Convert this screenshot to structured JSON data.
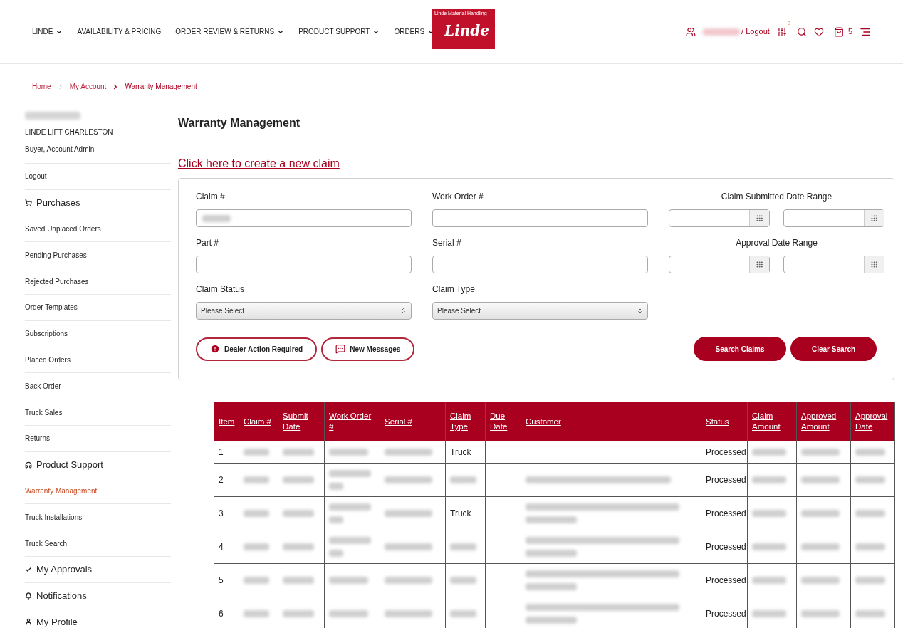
{
  "nav": [
    {
      "label": "LINDE",
      "dropdown": true
    },
    {
      "label": "AVAILABILITY & PRICING",
      "dropdown": false
    },
    {
      "label": "ORDER REVIEW & RETURNS",
      "dropdown": true
    },
    {
      "label": "PRODUCT SUPPORT",
      "dropdown": true
    },
    {
      "label": "ORDERS",
      "dropdown": true
    }
  ],
  "logo": {
    "tagline": "Linde Material Handling",
    "wordmark": "Linde"
  },
  "user_bar": {
    "name_blurred": true,
    "logout": "/ Logout",
    "compare_count": "0",
    "cart_count": "5"
  },
  "breadcrumb": [
    {
      "label": "Home",
      "current": false
    },
    {
      "label": "My Account",
      "current": false
    },
    {
      "label": "Warranty Management",
      "current": true
    }
  ],
  "sidebar": {
    "name_blurred": true,
    "company": "LINDE LIFT CHARLESTON",
    "role": "Buyer, Account Admin",
    "items": [
      {
        "kind": "link",
        "label": "Logout",
        "selected": false
      },
      {
        "kind": "heading",
        "label": "Purchases",
        "selected": false
      },
      {
        "kind": "link",
        "label": "Saved Unplaced Orders",
        "selected": false
      },
      {
        "kind": "link",
        "label": "Pending Purchases",
        "selected": false
      },
      {
        "kind": "link",
        "label": "Rejected Purchases",
        "selected": false
      },
      {
        "kind": "link",
        "label": "Order Templates",
        "selected": false
      },
      {
        "kind": "link",
        "label": "Subscriptions",
        "selected": false
      },
      {
        "kind": "link",
        "label": "Placed Orders",
        "selected": false
      },
      {
        "kind": "link",
        "label": "Back Order",
        "selected": false
      },
      {
        "kind": "link",
        "label": "Truck Sales",
        "selected": false
      },
      {
        "kind": "link",
        "label": "Returns",
        "selected": false
      },
      {
        "kind": "heading",
        "label": "Product Support",
        "selected": false
      },
      {
        "kind": "link",
        "label": "Warranty Management",
        "selected": true
      },
      {
        "kind": "link",
        "label": "Truck Installations",
        "selected": false
      },
      {
        "kind": "link",
        "label": "Truck Search",
        "selected": false
      },
      {
        "kind": "heading",
        "label": "My Approvals",
        "selected": false
      },
      {
        "kind": "heading",
        "label": "Notifications",
        "selected": false
      },
      {
        "kind": "heading",
        "label": "My Profile",
        "selected": false
      }
    ]
  },
  "page_title": "Warranty Management",
  "create_link": "Click here to create a new claim",
  "form": {
    "claim": {
      "label": "Claim #",
      "value_blurred": true
    },
    "work_order": {
      "label": "Work Order #"
    },
    "submitted_range": {
      "label": "Claim Submitted Date Range"
    },
    "part": {
      "label": "Part #"
    },
    "serial": {
      "label": "Serial #"
    },
    "approval_range": {
      "label": "Approval Date Range"
    },
    "claim_status": {
      "label": "Claim Status",
      "value": "Please Select"
    },
    "claim_type": {
      "label": "Claim Type",
      "value": "Please Select"
    },
    "filter_buttons": [
      {
        "label": "Dealer Action Required"
      },
      {
        "label": "New Messages"
      }
    ],
    "buttons": [
      "Search Claims",
      "Clear Search"
    ]
  },
  "table": {
    "columns": [
      "Item",
      "Claim #",
      "Submit Date",
      "Work Order #",
      "Serial #",
      "Claim Type",
      "Due Date",
      "Customer",
      "Status",
      "Claim Amount",
      "Approved Amount",
      "Approval Date"
    ],
    "rows": [
      {
        "cells": [
          {
            "kind": "text",
            "text": "1"
          },
          {
            "kind": "blurred"
          },
          {
            "kind": "blurred"
          },
          {
            "kind": "blurred"
          },
          {
            "kind": "blurred"
          },
          {
            "kind": "text",
            "text": "Truck"
          },
          {
            "kind": "empty"
          },
          {
            "kind": "empty"
          },
          {
            "kind": "text",
            "text": "Processed"
          },
          {
            "kind": "blurred"
          },
          {
            "kind": "blurred"
          },
          {
            "kind": "blurred"
          }
        ]
      },
      {
        "cells": [
          {
            "kind": "text",
            "text": "2"
          },
          {
            "kind": "blurred"
          },
          {
            "kind": "blurred"
          },
          {
            "kind": "blurred-wrap"
          },
          {
            "kind": "blurred"
          },
          {
            "kind": "blurred"
          },
          {
            "kind": "empty"
          },
          {
            "kind": "blurred"
          },
          {
            "kind": "text",
            "text": "Processed"
          },
          {
            "kind": "blurred"
          },
          {
            "kind": "blurred"
          },
          {
            "kind": "blurred"
          }
        ]
      },
      {
        "cells": [
          {
            "kind": "text",
            "text": "3"
          },
          {
            "kind": "blurred"
          },
          {
            "kind": "blurred"
          },
          {
            "kind": "blurred-wrap"
          },
          {
            "kind": "blurred"
          },
          {
            "kind": "text",
            "text": "Truck"
          },
          {
            "kind": "empty"
          },
          {
            "kind": "blurred-wrap"
          },
          {
            "kind": "text",
            "text": "Processed"
          },
          {
            "kind": "blurred"
          },
          {
            "kind": "blurred"
          },
          {
            "kind": "blurred"
          }
        ]
      },
      {
        "cells": [
          {
            "kind": "text",
            "text": "4"
          },
          {
            "kind": "blurred"
          },
          {
            "kind": "blurred"
          },
          {
            "kind": "blurred-wrap"
          },
          {
            "kind": "blurred"
          },
          {
            "kind": "blurred"
          },
          {
            "kind": "empty"
          },
          {
            "kind": "blurred-wrap"
          },
          {
            "kind": "text",
            "text": "Processed"
          },
          {
            "kind": "blurred"
          },
          {
            "kind": "blurred"
          },
          {
            "kind": "blurred"
          }
        ]
      },
      {
        "cells": [
          {
            "kind": "text",
            "text": "5"
          },
          {
            "kind": "blurred"
          },
          {
            "kind": "blurred"
          },
          {
            "kind": "blurred"
          },
          {
            "kind": "blurred"
          },
          {
            "kind": "blurred"
          },
          {
            "kind": "empty"
          },
          {
            "kind": "blurred-wrap"
          },
          {
            "kind": "text",
            "text": "Processed"
          },
          {
            "kind": "blurred"
          },
          {
            "kind": "blurred"
          },
          {
            "kind": "blurred"
          }
        ]
      },
      {
        "cells": [
          {
            "kind": "text",
            "text": "6"
          },
          {
            "kind": "blurred"
          },
          {
            "kind": "blurred"
          },
          {
            "kind": "blurred"
          },
          {
            "kind": "blurred"
          },
          {
            "kind": "blurred"
          },
          {
            "kind": "empty"
          },
          {
            "kind": "blurred-wrap"
          },
          {
            "kind": "text",
            "text": "Processed"
          },
          {
            "kind": "blurred"
          },
          {
            "kind": "blurred"
          },
          {
            "kind": "blurred"
          }
        ]
      }
    ]
  }
}
